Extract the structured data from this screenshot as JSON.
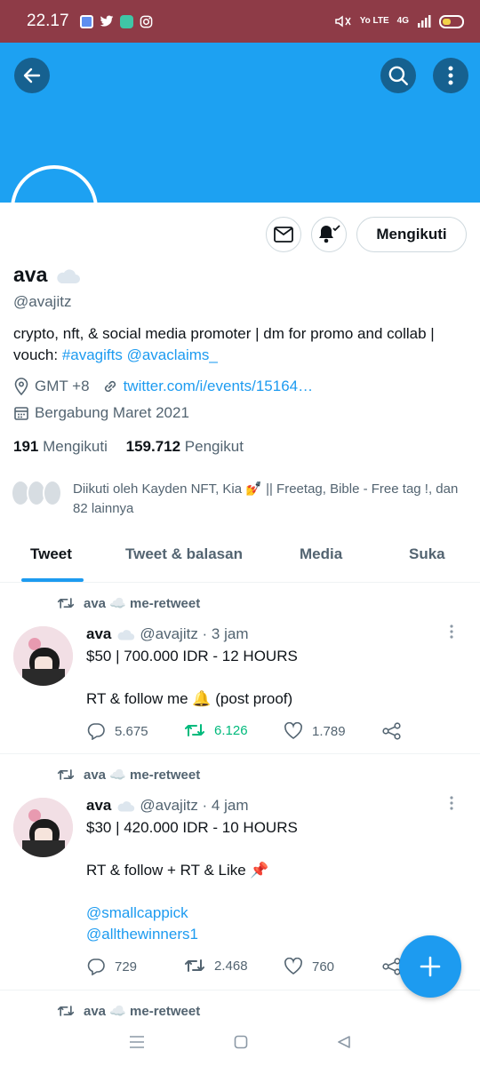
{
  "status_bar": {
    "time": "22.17",
    "net_text": "Yo LTE",
    "net_gen": "4G"
  },
  "profile": {
    "name": "ava",
    "handle": "@avajitz",
    "follow_button": "Mengikuti",
    "bio_text": "crypto, nft, & social media promoter | dm for promo and collab | vouch: ",
    "bio_tag": "#avagifts",
    "bio_mention": "@avaclaims_",
    "location": "GMT +8",
    "website": "twitter.com/i/events/15164…",
    "joined": "Bergabung Maret 2021",
    "following_count": "191",
    "following_label": "Mengikuti",
    "followers_count": "159.712",
    "followers_label": "Pengikut",
    "followed_by": "Diikuti oleh Kayden NFT, Kia 💅 || Freetag, Bible - Free tag !, dan 82 lainnya"
  },
  "tabs": [
    {
      "label": "Tweet"
    },
    {
      "label": "Tweet & balasan"
    },
    {
      "label": "Media"
    },
    {
      "label": "Suka"
    }
  ],
  "tweets": [
    {
      "retweet_label": "ava ☁️ me-retweet",
      "name": "ava",
      "handle_time": "@avajitz · 3 jam",
      "line1": "$50 | 700.000 IDR - 12 HOURS",
      "line2": "RT & follow me 🔔 (post proof)",
      "replies": "5.675",
      "retweets": "6.126",
      "likes": "1.789"
    },
    {
      "retweet_label": "ava ☁️ me-retweet",
      "name": "ava",
      "handle_time": "@avajitz · 4 jam",
      "line1": "$30 | 420.000 IDR - 10 HOURS",
      "line2": "RT & follow + RT & Like 📌",
      "mention1": "@smallcappick",
      "mention2": "@allthewinners1",
      "replies": "729",
      "retweets": "2.468",
      "likes": "760"
    },
    {
      "retweet_label": "ava ☁️ me-retweet"
    }
  ],
  "colors": {
    "accent": "#1d9bf0",
    "banner": "#1da1f2",
    "status_bar": "#8e3b47",
    "retweet_green": "#00ba7c"
  }
}
